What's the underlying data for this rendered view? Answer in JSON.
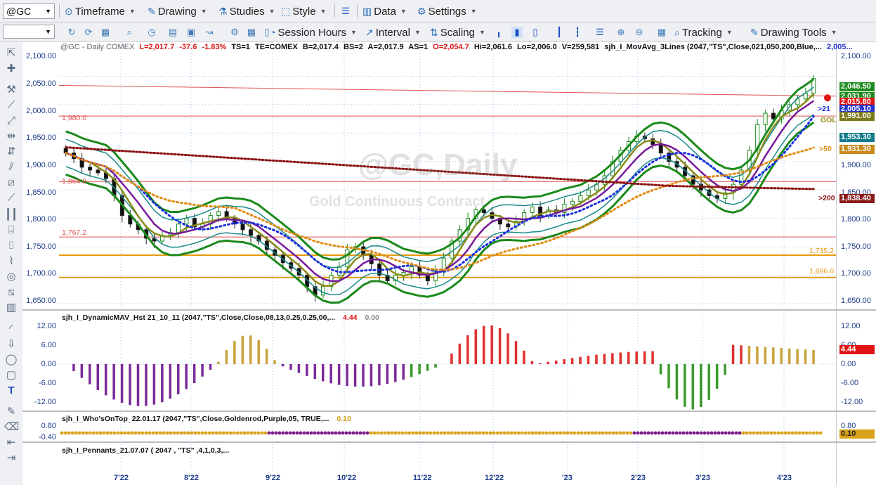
{
  "toolbar1": {
    "symbol": "@GC",
    "timeframe": "Timeframe",
    "drawing": "Drawing",
    "studies": "Studies",
    "style": "Style",
    "data": "Data",
    "settings": "Settings"
  },
  "toolbar2": {
    "session_hours": "Session Hours",
    "interval": "Interval",
    "scaling": "Scaling",
    "tracking": "Tracking",
    "drawing_tools": "Drawing Tools"
  },
  "info": {
    "symbol": "@GC - Daily  COMEX",
    "last": "L=2,017.7",
    "change": "-37.6",
    "pct": "-1.83%",
    "ts": "TS=1",
    "te": "TE=COMEX",
    "bid": "B=2,017.4",
    "bs": "BS=2",
    "ask": "A=2,017.9",
    "as": "AS=1",
    "open": "O=2,054.7",
    "hi": "Hi=2,061.6",
    "lo": "Lo=2,006.0",
    "vol": "V=259,581",
    "study": "sjh_I_MovAvg_3Lines (2047,\"TS\",Close,021,050,200,Blue,...",
    "study_val": "2,005..."
  },
  "watermark": {
    "title": "@GC,Daily",
    "subtitle": "Gold Continuous Contract"
  },
  "price_scale": [
    "2,100.00",
    "2,050.00",
    "2,000.00",
    "1,950.00",
    "1,900.00",
    "1,850.00",
    "1,800.00",
    "1,750.00",
    "1,700.00",
    "1,650.00"
  ],
  "price_badges": [
    {
      "text": "2,046.50",
      "color": "#1f8a1f"
    },
    {
      "text": "2,031.90",
      "color": "#1f8a1f"
    },
    {
      "text": "2,015.80",
      "color": "#e01414"
    },
    {
      "text": "2,005.10",
      "color": "#2233cc"
    },
    {
      "text": "1,991.00",
      "color": "#7a7a1a"
    },
    {
      "text": "1,953.30",
      "color": "#127a8a"
    },
    {
      "text": "1,931.30",
      "color": "#c78a1a"
    },
    {
      "text": "1,838.40",
      "color": "#8a1a1a"
    }
  ],
  "ma_labels": {
    "fast": ">21",
    "gold": "GOL",
    "mid": ">50",
    "slow": ">200"
  },
  "hlines": [
    {
      "label": "1,980.0",
      "color": "#e05050"
    },
    {
      "label": "1,864.8",
      "color": "#e05050"
    },
    {
      "label": "1,767.2",
      "color": "#e05050"
    },
    {
      "label": "1,735.2",
      "color": "#e39a10"
    },
    {
      "label": "1,696.0",
      "color": "#e39a10"
    }
  ],
  "ind1": {
    "title": "sjh_I_DynamicMAV_Hst 21_10_11 (2047,\"TS\",Close,Close,08,13,0.25,0.25,00,...",
    "v1": "4.44",
    "v2": "0.00",
    "scale": [
      "12.00",
      "6.00",
      "0.00",
      "-6.00",
      "-12.00"
    ],
    "badge": "4.44"
  },
  "ind2": {
    "title": "sjh_I_Who'sOnTop_22.01.17 (2047,\"TS\",Close,Goldenrod,Purple,05, TRUE,...",
    "v1": "0.10",
    "scale": [
      "0.80",
      "-0.40"
    ],
    "badge": "0.10"
  },
  "ind3": {
    "title": "sjh_I_Pennants_21.07.07 ( 2047 , \"TS\" ,4,1,0,3,..."
  },
  "x_labels": [
    "7'22",
    "8'22",
    "9'22",
    "10'22",
    "11'22",
    "12'22",
    "'23",
    "2'23",
    "3'23",
    "4'23"
  ],
  "chart_data": {
    "type": "candlestick",
    "title": "@GC,Daily",
    "subtitle": "Gold Continuous Contract",
    "x": [
      "7'22",
      "8'22",
      "9'22",
      "10'22",
      "11'22",
      "12'22",
      "'23",
      "2'23",
      "3'23",
      "4'23"
    ],
    "ylim": [
      1640,
      2110
    ],
    "close_path": [
      1915,
      1905,
      1890,
      1885,
      1880,
      1870,
      1840,
      1805,
      1790,
      1780,
      1765,
      1760,
      1770,
      1775,
      1790,
      1800,
      1785,
      1790,
      1805,
      1812,
      1800,
      1790,
      1780,
      1770,
      1760,
      1745,
      1735,
      1722,
      1712,
      1700,
      1680,
      1665,
      1680,
      1700,
      1715,
      1745,
      1750,
      1735,
      1720,
      1700,
      1690,
      1700,
      1705,
      1715,
      1700,
      1690,
      1710,
      1730,
      1760,
      1780,
      1800,
      1815,
      1810,
      1800,
      1790,
      1785,
      1795,
      1810,
      1820,
      1805,
      1815,
      1810,
      1825,
      1830,
      1840,
      1850,
      1860,
      1875,
      1900,
      1920,
      1935,
      1945,
      1940,
      1930,
      1915,
      1900,
      1890,
      1875,
      1860,
      1850,
      1840,
      1835,
      1845,
      1860,
      1885,
      1920,
      1965,
      1985,
      1975,
      1990,
      2000,
      2010,
      2020,
      2046
    ],
    "series": [
      {
        "name": ">21",
        "color": "#1a2fe0"
      },
      {
        "name": ">50",
        "color": "#e08a10"
      },
      {
        "name": ">200",
        "color": "#8a1010"
      }
    ]
  }
}
